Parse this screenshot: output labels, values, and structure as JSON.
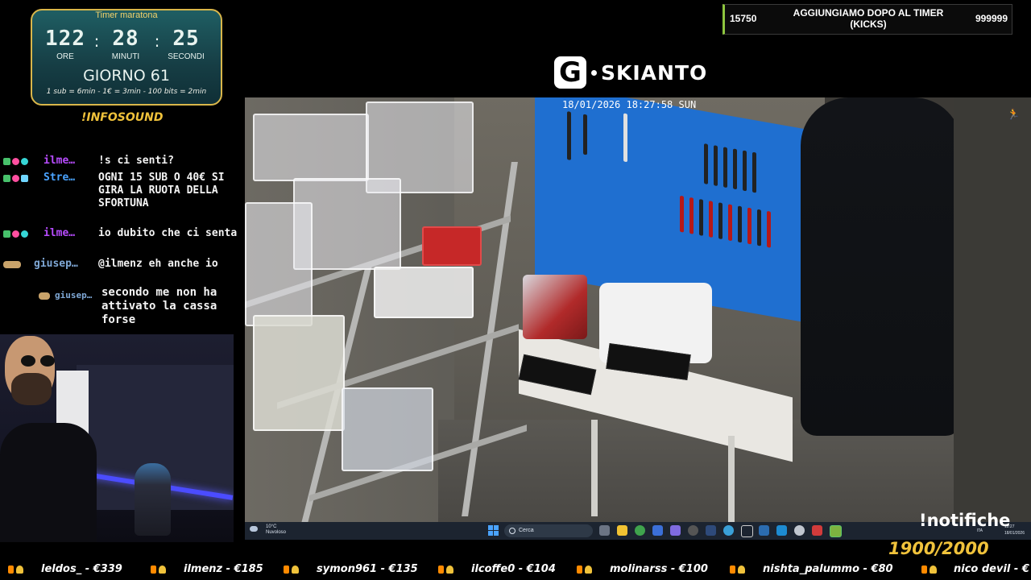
{
  "timer": {
    "title": "Timer maratona",
    "hours": "122",
    "minutes": "28",
    "seconds": "25",
    "hours_label": "ORE",
    "minutes_label": "MINUTI",
    "seconds_label": "SECONDI",
    "day": "GIORNO 61",
    "rates": "1 sub = 6min - 1€ = 3min - 100 bits = 2min"
  },
  "infosound": "!INFOSOUND",
  "chat": [
    {
      "user": "ilme…",
      "text": "!s ci senti?",
      "user_color": "#b84cff"
    },
    {
      "user": "Stre…",
      "text": "OGNI 15 SUB O 40€ SI GIRA LA RUOTA DELLA SFORTUNA",
      "user_color": "#4aa3ff"
    },
    {
      "user": "ilme…",
      "text": "io dubito che ci senta",
      "user_color": "#b84cff"
    },
    {
      "user": "giusep…",
      "text": "@ilmenz eh anche io",
      "user_color": "#7fa8d6"
    },
    {
      "user": "giusep…",
      "text": "secondo me non ha attivato la cassa forse",
      "user_color": "#7fa8d6"
    }
  ],
  "goal": {
    "left": "15750",
    "label": "AGGIUNGIAMO DOPO AL TIMER (KICKS)",
    "right": "999999"
  },
  "logo": {
    "letter": "G",
    "text": "SKIANTO"
  },
  "feed": {
    "timestamp": "18/01/2026 18:27:58 SUN"
  },
  "taskbar": {
    "weather_temp": "10°C",
    "weather_desc": "Nuvoloso",
    "search_label": "Cerca",
    "tray_lang": "ITA",
    "tray_time": "18:27",
    "tray_date": "18/01/2026"
  },
  "notifiche": "!notifiche",
  "counter": "1900/2000",
  "donations": [
    {
      "text": "leldos_ - €339"
    },
    {
      "text": "ilmenz - €185"
    },
    {
      "text": "symon961 - €135"
    },
    {
      "text": "ilcoffe0 - €104"
    },
    {
      "text": "molinarss - €100"
    },
    {
      "text": "nishta_palummo - €80"
    },
    {
      "text": "nico devil - €"
    }
  ],
  "colors": {
    "gold": "#f0c23b",
    "goal_accent": "#8ec63f",
    "timer_bg": "#1f5e63"
  },
  "icons": [
    "sub-badge-icon",
    "verified-badge-icon",
    "moderator-badge-icon",
    "trophy-icon",
    "fire-icon",
    "walk-icon",
    "windows-start-icon",
    "search-icon",
    "weather-icon"
  ]
}
